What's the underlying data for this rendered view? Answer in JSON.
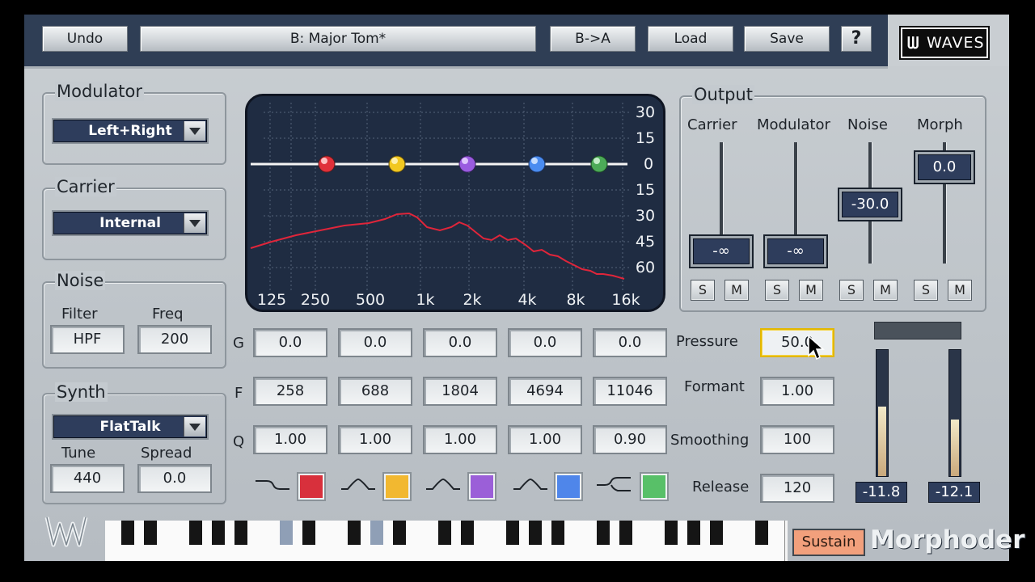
{
  "toolbar": {
    "undo_label": "Undo",
    "preset_name": "B: Major Tom*",
    "copy_label": "B->A",
    "load_label": "Load",
    "save_label": "Save",
    "help_label": "?",
    "logo_text": "WAVES"
  },
  "modulator": {
    "title": "Modulator",
    "selected": "Left+Right"
  },
  "carrier": {
    "title": "Carrier",
    "selected": "Internal"
  },
  "noise": {
    "title": "Noise",
    "filter_label": "Filter",
    "freq_label": "Freq",
    "filter_value": "HPF",
    "freq_value": "200"
  },
  "synth": {
    "title": "Synth",
    "selected": "FlatTalk",
    "tune_label": "Tune",
    "spread_label": "Spread",
    "tune_value": "440",
    "spread_value": "0.0"
  },
  "eq_display": {
    "db_labels": [
      "30",
      "15",
      "0",
      "15",
      "30",
      "45",
      "60"
    ],
    "freq_labels": [
      "125",
      "250",
      "500",
      "1k",
      "2k",
      "4k",
      "8k",
      "16k"
    ],
    "band_colors": [
      "#e0303a",
      "#f2c820",
      "#9a5ce0",
      "#4a8cf0",
      "#4caa58"
    ]
  },
  "bands": {
    "row_labels": [
      "G",
      "F",
      "Q"
    ],
    "gain": [
      "0.0",
      "0.0",
      "0.0",
      "0.0",
      "0.0"
    ],
    "freq": [
      "258",
      "688",
      "1804",
      "4694",
      "11046"
    ],
    "q": [
      "1.00",
      "1.00",
      "1.00",
      "1.00",
      "0.90"
    ],
    "filter_types": [
      "low-shelf",
      "bell",
      "bell",
      "bell",
      "high-shelf"
    ],
    "swatch_colors": [
      "#d8303c",
      "#f2b830",
      "#9b5fd8",
      "#4f86ea",
      "#58c068"
    ]
  },
  "params": {
    "pressure_label": "Pressure",
    "pressure_value": "50.0",
    "formant_label": "Formant",
    "formant_value": "1.00",
    "smoothing_label": "Smoothing",
    "smoothing_value": "100",
    "release_label": "Release",
    "release_value": "120"
  },
  "output": {
    "title": "Output",
    "carrier_label": "Carrier",
    "carrier_value": "-∞",
    "modulator_label": "Modulator",
    "modulator_value": "-∞",
    "noise_label": "Noise",
    "noise_value": "-30.0",
    "morph_label": "Morph",
    "morph_value": "0.0",
    "solo_label": "S",
    "mute_label": "M"
  },
  "meters": {
    "left_value": "-11.8",
    "right_value": "-12.1",
    "left_level": 0.55,
    "right_level": 0.45
  },
  "footer": {
    "sustain_label": "Sustain",
    "product_name": "Morphoder"
  }
}
